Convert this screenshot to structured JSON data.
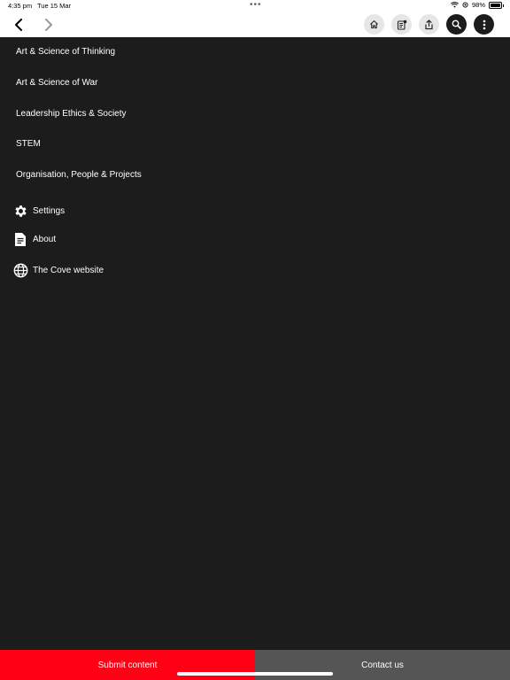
{
  "status_bar": {
    "time": "4:35 pm",
    "date": "Tue 15 Mar",
    "battery": "98%",
    "battery_level": 0.98
  },
  "toolbar": {
    "back_icon": "chevron-left-icon",
    "forward_icon": "chevron-right-icon",
    "buttons": [
      "home-icon",
      "notes-icon",
      "share-icon",
      "search-icon",
      "more-vertical-icon"
    ]
  },
  "menu": {
    "categories": [
      "Art & Science of Thinking",
      "Art & Science of War",
      "Leadership Ethics & Society",
      "STEM",
      "Organisation, People & Projects"
    ],
    "settings": "Settings",
    "about": "About",
    "website": "The Cove website"
  },
  "footer": {
    "submit": "Submit content",
    "contact": "Contact us"
  },
  "colors": {
    "background": "#1b1c1b",
    "accent": "#ff0015",
    "secondary": "#555555"
  }
}
